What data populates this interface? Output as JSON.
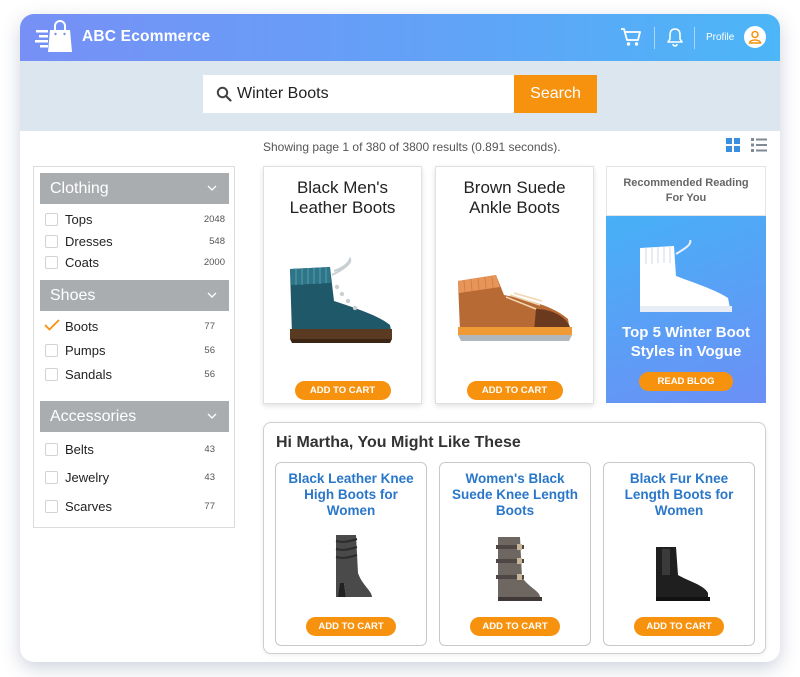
{
  "header": {
    "title": "ABC Ecommerce",
    "profile_label": "Profile",
    "icons": [
      "shopping-bag-icon",
      "cart-icon",
      "bell-icon",
      "user-icon"
    ]
  },
  "search": {
    "value": "Winter Boots",
    "button_label": "Search"
  },
  "results": {
    "summary": "Showing page 1 of 380 of 3800 results (0.891 seconds)."
  },
  "sidebar": {
    "categories": [
      {
        "name": "Clothing",
        "items": [
          {
            "label": "Tops",
            "count": "2048",
            "checked": false
          },
          {
            "label": "Dresses",
            "count": "548",
            "checked": false
          },
          {
            "label": "Coats",
            "count": "2000",
            "checked": false
          }
        ]
      },
      {
        "name": "Shoes",
        "items": [
          {
            "label": "Boots",
            "count": "77",
            "checked": true
          },
          {
            "label": "Pumps",
            "count": "56",
            "checked": false
          },
          {
            "label": "Sandals",
            "count": "56",
            "checked": false
          }
        ]
      },
      {
        "name": "Accessories",
        "items": [
          {
            "label": "Belts",
            "count": "43",
            "checked": false
          },
          {
            "label": "Jewelry",
            "count": "43",
            "checked": false
          },
          {
            "label": "Scarves",
            "count": "77",
            "checked": false
          }
        ]
      }
    ]
  },
  "products": [
    {
      "title_line1": "Black Men's",
      "title_line2": "Leather Boots",
      "button": "ADD TO CART"
    },
    {
      "title_line1": "Brown Suede",
      "title_line2": "Ankle Boots",
      "button": "ADD TO CART"
    }
  ],
  "recommended": {
    "heading_line1": "Recommended Reading",
    "heading_line2": "For You",
    "title_line1": "Top 5 Winter Boot",
    "title_line2": "Styles in Vogue",
    "button": "READ BLOG"
  },
  "personal": {
    "heading": "Hi Martha, You Might Like These",
    "items": [
      {
        "line1": "Black Leather Knee",
        "line2": "High Boots for",
        "line3": "Women",
        "button": "ADD TO CART"
      },
      {
        "line1": "Women's Black",
        "line2": "Suede Knee Length",
        "line3": "Boots",
        "button": "ADD TO CART"
      },
      {
        "line1": "Black Fur Knee",
        "line2": "Length Boots for",
        "line3": "Women",
        "button": "ADD TO CART"
      }
    ]
  },
  "colors": {
    "accent": "#f7920f",
    "header_start": "#7790f6",
    "header_end": "#4cb6f7",
    "link": "#2a77c9",
    "category_header": "#a9adb0"
  }
}
